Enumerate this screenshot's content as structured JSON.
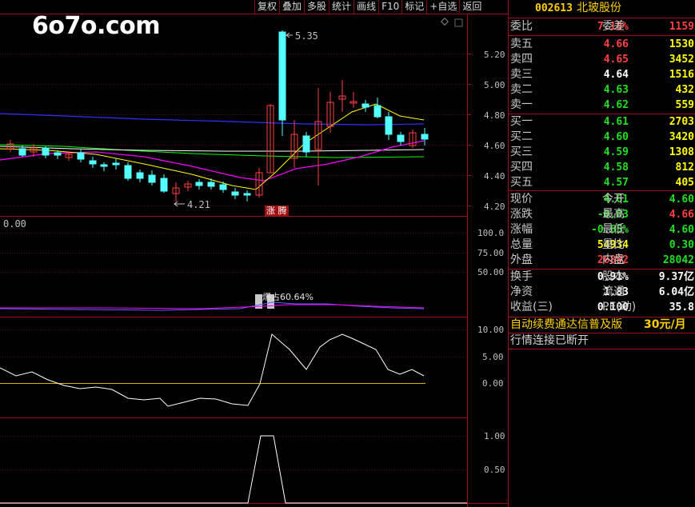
{
  "logo": "6o7o.com",
  "toolbar": [
    "复权",
    "叠加",
    "多股",
    "统计",
    "画线",
    "F10",
    "标记",
    "+自选",
    "返回"
  ],
  "chart": {
    "price_ticks": [
      "5.20",
      "5.00",
      "4.80",
      "4.60",
      "4.40",
      "4.20"
    ],
    "high_label": "5.35",
    "low_label": "4.21",
    "zt_tag": "涨 腾",
    "vol_value": "0.00",
    "vol_ticks": [
      "100.0",
      "75.00",
      "50.00"
    ],
    "vol_annotation": "爆占60.64%",
    "ind1_ticks": [
      "10.00",
      "5.00",
      "0.00"
    ],
    "ind2_ticks": [
      "1.00",
      "0.50"
    ]
  },
  "stock": {
    "code": "002613",
    "name": "北玻股份"
  },
  "committee": {
    "ratio_label": "委比",
    "ratio": "7.18%",
    "diff_label": "委差",
    "diff": "1159"
  },
  "asks": [
    {
      "label": "卖五",
      "price": "4.66",
      "vol": "1530",
      "color": "red"
    },
    {
      "label": "卖四",
      "price": "4.65",
      "vol": "3452",
      "color": "red"
    },
    {
      "label": "卖三",
      "price": "4.64",
      "vol": "1516",
      "color": "wht"
    },
    {
      "label": "卖二",
      "price": "4.63",
      "vol": "432",
      "color": "grn"
    },
    {
      "label": "卖一",
      "price": "4.62",
      "vol": "559",
      "color": "grn"
    }
  ],
  "bids": [
    {
      "label": "买一",
      "price": "4.61",
      "vol": "2703",
      "color": "grn"
    },
    {
      "label": "买二",
      "price": "4.60",
      "vol": "3420",
      "color": "grn"
    },
    {
      "label": "买三",
      "price": "4.59",
      "vol": "1308",
      "color": "grn"
    },
    {
      "label": "买四",
      "price": "4.58",
      "vol": "812",
      "color": "grn"
    },
    {
      "label": "买五",
      "price": "4.57",
      "vol": "405",
      "color": "grn"
    }
  ],
  "quote": [
    {
      "l1": "现价",
      "v1": "4.61",
      "c1": "grn",
      "l2": "今开",
      "v2": "4.60",
      "c2": "grn"
    },
    {
      "l1": "涨跌",
      "v1": "-0.03",
      "c1": "grn",
      "l2": "最高",
      "v2": "4.66",
      "c2": "red"
    },
    {
      "l1": "涨幅",
      "v1": "-0.65%",
      "c1": "grn",
      "l2": "最低",
      "v2": "4.60",
      "c2": "grn"
    },
    {
      "l1": "总量",
      "v1": "54934",
      "c1": "yel",
      "l2": "量比",
      "v2": "0.30",
      "c2": "grn"
    },
    {
      "l1": "外盘",
      "v1": "26892",
      "c1": "red",
      "l2": "内盘",
      "v2": "28042",
      "c2": "grn"
    }
  ],
  "fund": [
    {
      "l1": "换手",
      "v1": "0.91%",
      "l2": "股本",
      "v2": "9.37亿"
    },
    {
      "l1": "净资",
      "v1": "1.83",
      "l2": "流通",
      "v2": "6.04亿"
    },
    {
      "l1": "收益(三)",
      "v1": "0.100",
      "l2": "PE(动)",
      "v2": "35.8"
    }
  ],
  "notice": {
    "text": "自动续费通达信普及版",
    "price": "30元/月"
  },
  "status": "行情连接已断开",
  "colors": {
    "bg": "#000000",
    "frame": "#a01010",
    "up": "#ff4040",
    "down": "#54ffff",
    "ma5": "#ffffff",
    "ma10": "#ffff00",
    "ma20": "#ff00ff",
    "ma60": "#00ff00",
    "ma120": "#3030ff"
  }
}
